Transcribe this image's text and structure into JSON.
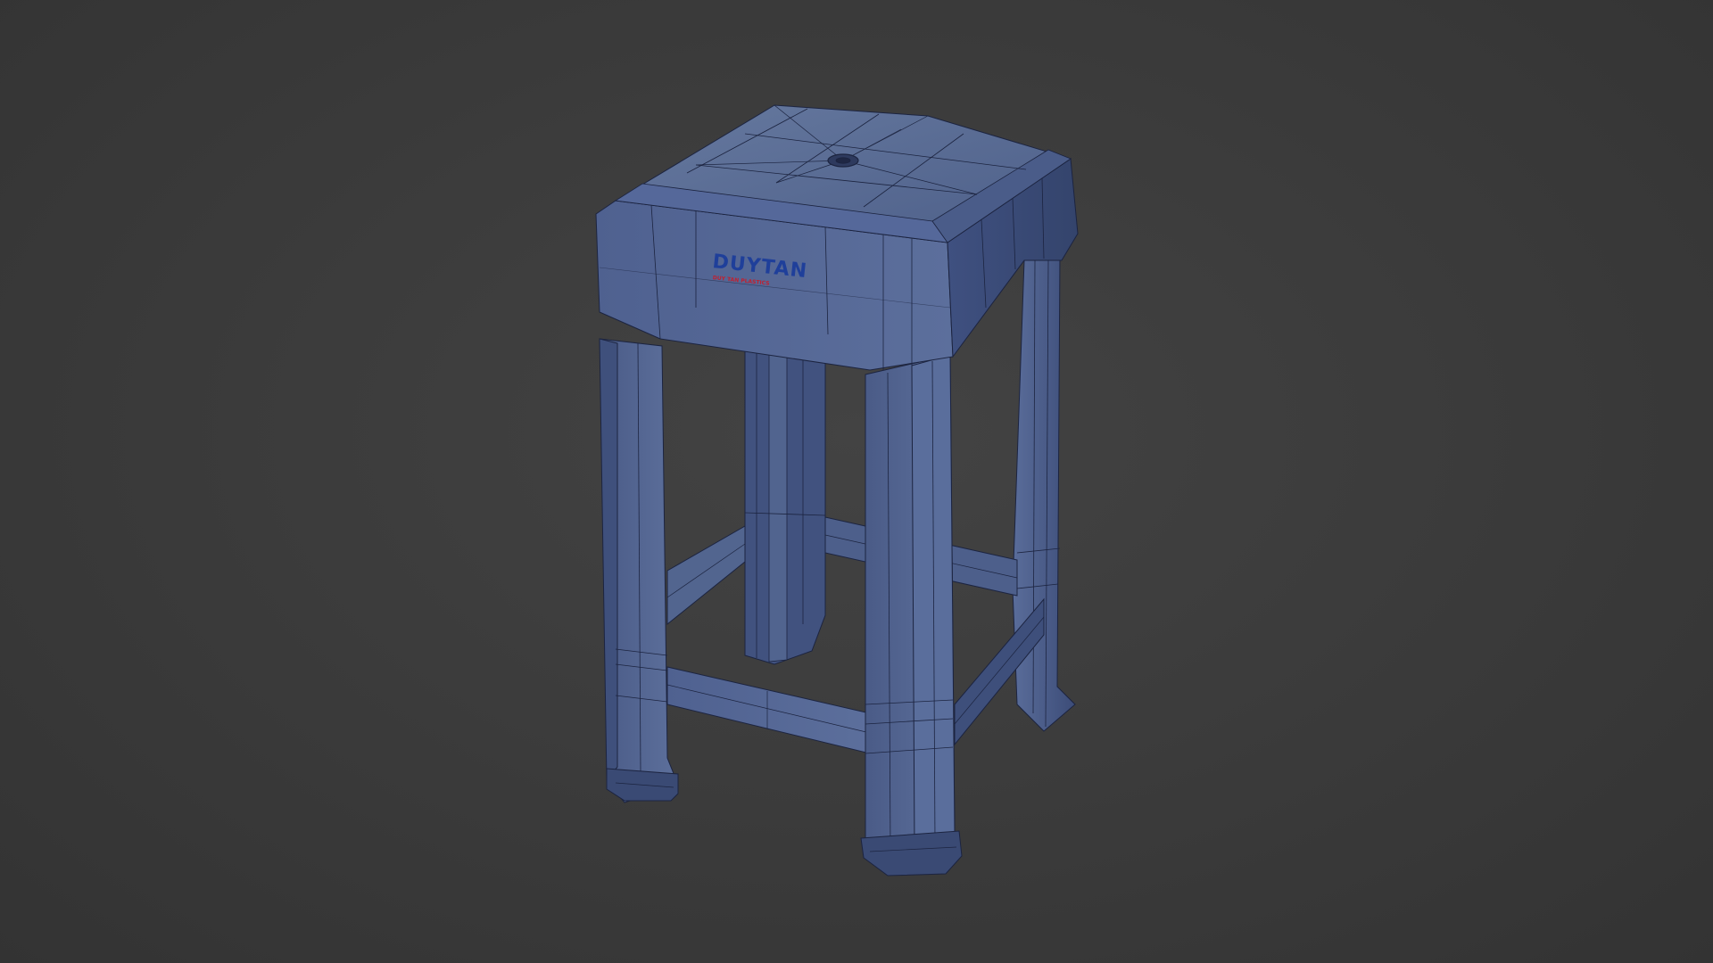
{
  "scene": {
    "subject": "plastic-stool-wireframe-render",
    "colors": {
      "background": "#3b3b3b",
      "stool_light": "#5a6f9e",
      "stool_mid": "#4a5d8a",
      "stool_dark": "#34446a",
      "wire": "#1c2440",
      "logo_blue": "#1f3f9a",
      "logo_red": "#c02030"
    }
  },
  "logo": {
    "brand": "DUYTAN",
    "tagline": "DUY TAN PLASTICS"
  }
}
